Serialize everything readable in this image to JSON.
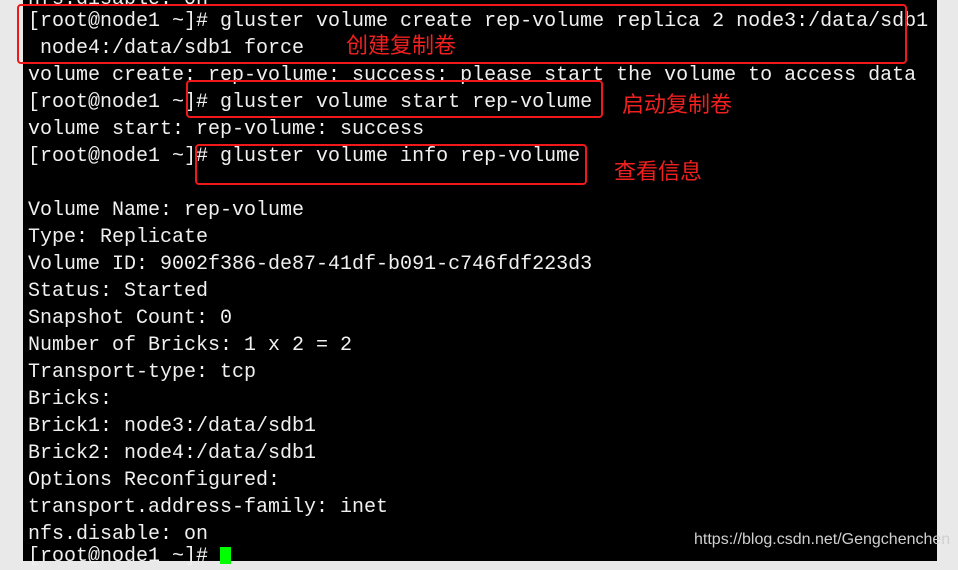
{
  "terminal": {
    "lines": [
      "nfs.disable: on",
      "[root@node1 ~]# gluster volume create rep-volume replica 2 node3:/data/sdb1",
      " node4:/data/sdb1 force",
      "volume create: rep-volume: success: please start the volume to access data",
      "[root@node1 ~]# gluster volume start rep-volume",
      "volume start: rep-volume: success",
      "[root@node1 ~]# gluster volume info rep-volume",
      "",
      "Volume Name: rep-volume",
      "Type: Replicate",
      "Volume ID: 9002f386-de87-41df-b091-c746fdf223d3",
      "Status: Started",
      "Snapshot Count: 0",
      "Number of Bricks: 1 x 2 = 2",
      "Transport-type: tcp",
      "Bricks:",
      "Brick1: node3:/data/sdb1",
      "Brick2: node4:/data/sdb1",
      "Options Reconfigured:",
      "transport.address-family: inet",
      "nfs.disable: on",
      "[root@node1 ~]# "
    ],
    "cursor_color": "#00ff00"
  },
  "annotations": {
    "create": "创建复制卷",
    "start": "启动复制卷",
    "info": "查看信息",
    "color": "#f01818"
  },
  "watermark": "https://blog.csdn.net/Gengchenchen"
}
